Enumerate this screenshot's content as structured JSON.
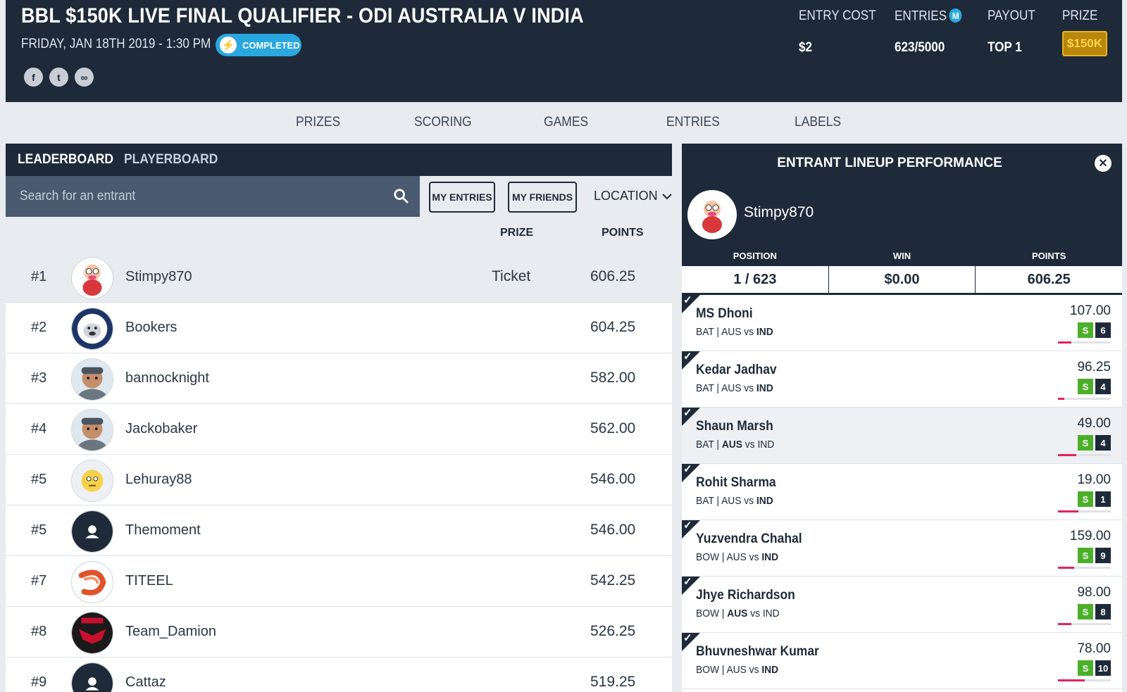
{
  "header": {
    "title": "BBL $150K LIVE FINAL QUALIFIER - ODI AUSTRALIA V INDIA",
    "date": "FRIDAY, JAN 18TH 2019 - 1:30 PM",
    "status": "COMPLETED",
    "socials": [
      {
        "name": "facebook-icon",
        "glyph": "f"
      },
      {
        "name": "twitter-icon",
        "glyph": "t"
      },
      {
        "name": "link-icon",
        "glyph": "∞"
      }
    ],
    "entry_cost_label": "ENTRY COST",
    "entry_cost_value": "$2",
    "entries_label": "ENTRIES",
    "entries_badge": "M",
    "entries_value": "623/5000",
    "payout_label": "PAYOUT",
    "payout_value": "TOP 1",
    "prize_label": "PRIZE",
    "prize_badge": "$150K"
  },
  "tabs": [
    "PRIZES",
    "SCORING",
    "GAMES",
    "ENTRIES",
    "LABELS"
  ],
  "leaderboard": {
    "tab_active": "LEADERBOARD",
    "tab_other": "PLAYERBOARD",
    "search_placeholder": "Search for an entrant",
    "my_entries": "MY ENTRIES",
    "my_friends": "MY FRIENDS",
    "location": "LOCATION",
    "col_prize": "PRIZE",
    "col_points": "POINTS",
    "rows": [
      {
        "rank": "#1",
        "name": "Stimpy870",
        "prize": "Ticket",
        "points": "606.25",
        "avatar": "cartoon"
      },
      {
        "rank": "#2",
        "name": "Bookers",
        "prize": "",
        "points": "604.25",
        "avatar": "bulldog"
      },
      {
        "rank": "#3",
        "name": "bannocknight",
        "prize": "",
        "points": "582.00",
        "avatar": "person"
      },
      {
        "rank": "#4",
        "name": "Jackobaker",
        "prize": "",
        "points": "562.00",
        "avatar": "person"
      },
      {
        "rank": "#5",
        "name": "Lehuray88",
        "prize": "",
        "points": "546.00",
        "avatar": "emoji"
      },
      {
        "rank": "#5",
        "name": "Themoment",
        "prize": "",
        "points": "546.00",
        "avatar": "default"
      },
      {
        "rank": "#7",
        "name": "TITEEL",
        "prize": "",
        "points": "542.25",
        "avatar": "shrimp"
      },
      {
        "rank": "#8",
        "name": "Team_Damion",
        "prize": "",
        "points": "526.25",
        "avatar": "bombers"
      },
      {
        "rank": "#9",
        "name": "Cattaz",
        "prize": "",
        "points": "519.25",
        "avatar": "default"
      }
    ]
  },
  "lineup": {
    "title": "ENTRANT LINEUP PERFORMANCE",
    "user": "Stimpy870",
    "position_label": "POSITION",
    "position_value": "1 / 623",
    "win_label": "WIN",
    "win_value": "$0.00",
    "points_label": "POINTS",
    "points_value": "606.25",
    "players": [
      {
        "name": "MS Dhoni",
        "role": "BAT",
        "team1": "AUS",
        "vs": "vs",
        "team2": "IND",
        "bold_team": "IND",
        "points": "107.00",
        "s": "S",
        "n": "6",
        "progress": 0.25
      },
      {
        "name": "Kedar Jadhav",
        "role": "BAT",
        "team1": "AUS",
        "vs": "vs",
        "team2": "IND",
        "bold_team": "IND",
        "points": "96.25",
        "s": "S",
        "n": "4",
        "progress": 0.12
      },
      {
        "name": "Shaun Marsh",
        "role": "BAT",
        "team1": "AUS",
        "vs": "vs",
        "team2": "IND",
        "bold_team": "AUS",
        "points": "49.00",
        "s": "S",
        "n": "4",
        "progress": 0.35
      },
      {
        "name": "Rohit Sharma",
        "role": "BAT",
        "team1": "AUS",
        "vs": "vs",
        "team2": "IND",
        "bold_team": "IND",
        "points": "19.00",
        "s": "S",
        "n": "1",
        "progress": 0.38
      },
      {
        "name": "Yuzvendra Chahal",
        "role": "BOW",
        "team1": "AUS",
        "vs": "vs",
        "team2": "IND",
        "bold_team": "IND",
        "points": "159.00",
        "s": "S",
        "n": "9",
        "progress": 0.3
      },
      {
        "name": "Jhye Richardson",
        "role": "BOW",
        "team1": "AUS",
        "vs": "vs",
        "team2": "IND",
        "bold_team": "AUS",
        "points": "98.00",
        "s": "S",
        "n": "8",
        "progress": 0.25
      },
      {
        "name": "Bhuvneshwar Kumar",
        "role": "BOW",
        "team1": "AUS",
        "vs": "vs",
        "team2": "IND",
        "bold_team": "IND",
        "points": "78.00",
        "s": "S",
        "n": "10",
        "progress": 0.5
      }
    ]
  }
}
